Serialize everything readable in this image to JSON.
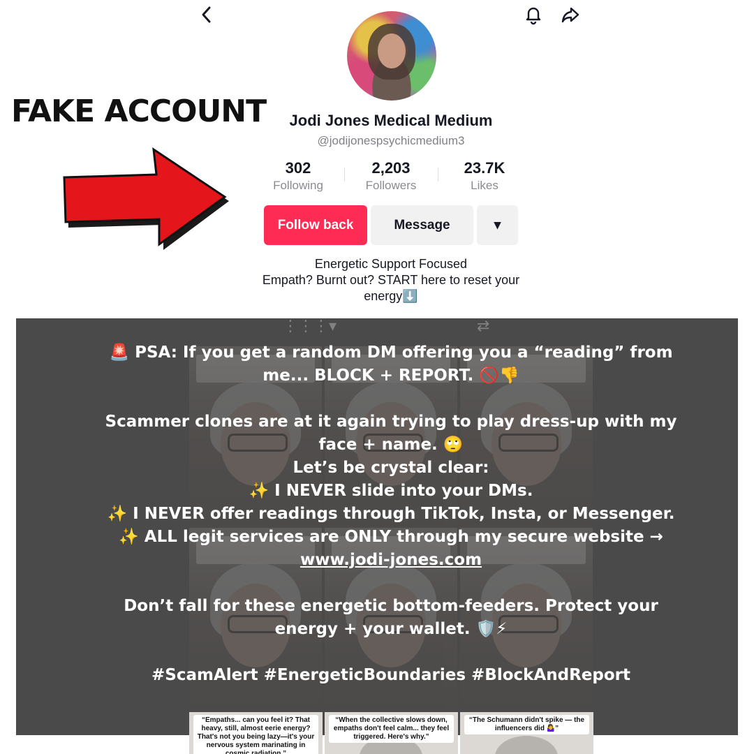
{
  "top_bar": {
    "back_icon": "chevron-left-icon",
    "bell_icon": "bell-icon",
    "share_icon": "share-arrow-icon"
  },
  "overlay": {
    "fake_label": "FAKE ACCOUNT",
    "arrow_color": "#e4161b"
  },
  "profile": {
    "name": "Jodi Jones Medical Medium",
    "handle": "@jodijonespsychicmedium3",
    "stats": [
      {
        "value": "302",
        "label": "Following"
      },
      {
        "value": "2,203",
        "label": "Followers"
      },
      {
        "value": "23.7K",
        "label": "Likes"
      }
    ],
    "buttons": {
      "follow": "Follow back",
      "message": "Message",
      "more": "▾"
    },
    "bio": [
      "Energetic Support Focused",
      "Empath? Burnt out? START here to reset your",
      "energy⬇️"
    ]
  },
  "psa": {
    "lines": [
      "🚨 PSA: If you get a random DM offering you a “reading” from",
      "me... BLOCK + REPORT. 🚫👎",
      "",
      "Scammer clones are at it again trying to play dress-up with my",
      "face + name. 🙄",
      "Let’s be crystal clear:",
      "✨ I NEVER slide into your DMs.",
      "✨ I NEVER offer readings through TikTok, Insta, or Messenger.",
      "✨ ALL legit services are ONLY through my secure website →"
    ],
    "link": "www.jodi-jones.com",
    "lines_after": [
      "",
      "Don’t fall for these energetic bottom-feeders. Protect your",
      "energy + your wallet. 🛡️⚡",
      "",
      "#ScamAlert #EnergeticBoundaries #BlockAndReport"
    ]
  },
  "bottom_thumbs": [
    "“Empaths... can you feel it? That heavy, still, almost eerie energy? That's not you being lazy—it's your nervous system marinating in cosmic radiation.”",
    "“When the collective slows down, empaths don't feel calm... they feel triggered. Here's why.”",
    "“The Schumann didn't spike — the influencers did 🤷‍♀️”"
  ]
}
